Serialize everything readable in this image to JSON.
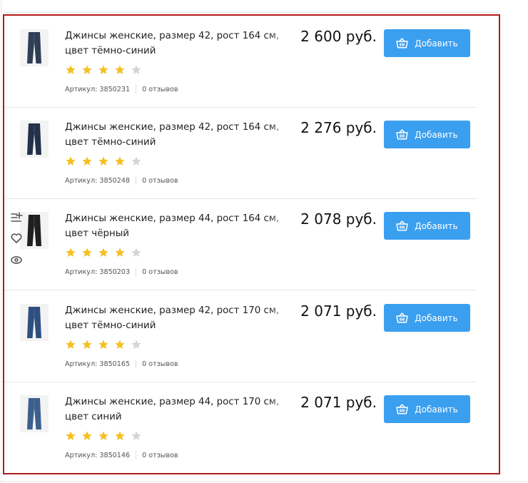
{
  "colors": {
    "accent": "#3b9ff0",
    "star_active": "#f5c024",
    "star_inactive": "#d5d5d5",
    "frame_highlight": "#b31b1b"
  },
  "side_actions": [
    {
      "icon": "compare-list-icon"
    },
    {
      "icon": "heart-icon"
    },
    {
      "icon": "eye-icon"
    }
  ],
  "products": [
    {
      "title": "Джинсы женские, размер 42, рост 164 см, цвет тёмно-синий",
      "price": "2 600 руб.",
      "rating": 4,
      "rating_max": 5,
      "sku_label": "Артикул: 3850231",
      "reviews_label": "0 отзывов",
      "add_label": "Добавить",
      "image": "jeans-dark-blue-photo"
    },
    {
      "title": "Джинсы женские, размер 42, рост 164 см, цвет тёмно-синий",
      "price": "2 276 руб.",
      "rating": 4,
      "rating_max": 5,
      "sku_label": "Артикул: 3850248",
      "reviews_label": "0 отзывов",
      "add_label": "Добавить",
      "image": "jeans-dark-blue-full-photo"
    },
    {
      "title": "Джинсы женские, размер 44, рост 164 см, цвет чёрный",
      "price": "2 078 руб.",
      "rating": 4,
      "rating_max": 5,
      "sku_label": "Артикул: 3850203",
      "reviews_label": "0 отзывов",
      "add_label": "Добавить",
      "image": "jeans-black-photo"
    },
    {
      "title": "Джинсы женские, размер 42, рост 170 см, цвет тёмно-синий",
      "price": "2 071 руб.",
      "rating": 4,
      "rating_max": 5,
      "sku_label": "Артикул: 3850165",
      "reviews_label": "0 отзывов",
      "add_label": "Добавить",
      "image": "jeans-blue-photo"
    },
    {
      "title": "Джинсы женские, размер 44, рост 170 см, цвет синий",
      "price": "2 071 руб.",
      "rating": 4,
      "rating_max": 5,
      "sku_label": "Артикул: 3850146",
      "reviews_label": "0 отзывов",
      "add_label": "Добавить",
      "image": "jeans-medium-blue-photo"
    }
  ]
}
